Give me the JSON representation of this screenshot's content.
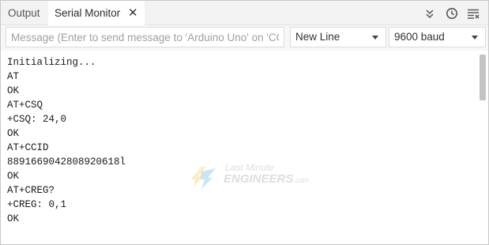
{
  "tabs": {
    "output_label": "Output",
    "serial_label": "Serial Monitor",
    "close_glyph": "✕"
  },
  "toolbar": {
    "icons": [
      "collapse-icon",
      "timestamp-icon",
      "clear-output-icon"
    ]
  },
  "input": {
    "placeholder": "Message (Enter to send message to 'Arduino Uno' on 'CO...",
    "value": ""
  },
  "line_ending": {
    "selected": "New Line"
  },
  "baud": {
    "selected": "9600 baud"
  },
  "output_lines": [
    "Initializing...",
    "AT",
    "OK",
    "AT+CSQ",
    "+CSQ: 24,0",
    "OK",
    "AT+CCID",
    "8891669042808920618l",
    "OK",
    "AT+CREG?",
    "+CREG: 0,1",
    "OK"
  ],
  "watermark": {
    "line1": "Last Minute",
    "line2": "ENGINEERS",
    "suffix": ".com"
  },
  "colors": {
    "accent_yellow": "#f4c430",
    "accent_blue": "#4aa3df"
  }
}
